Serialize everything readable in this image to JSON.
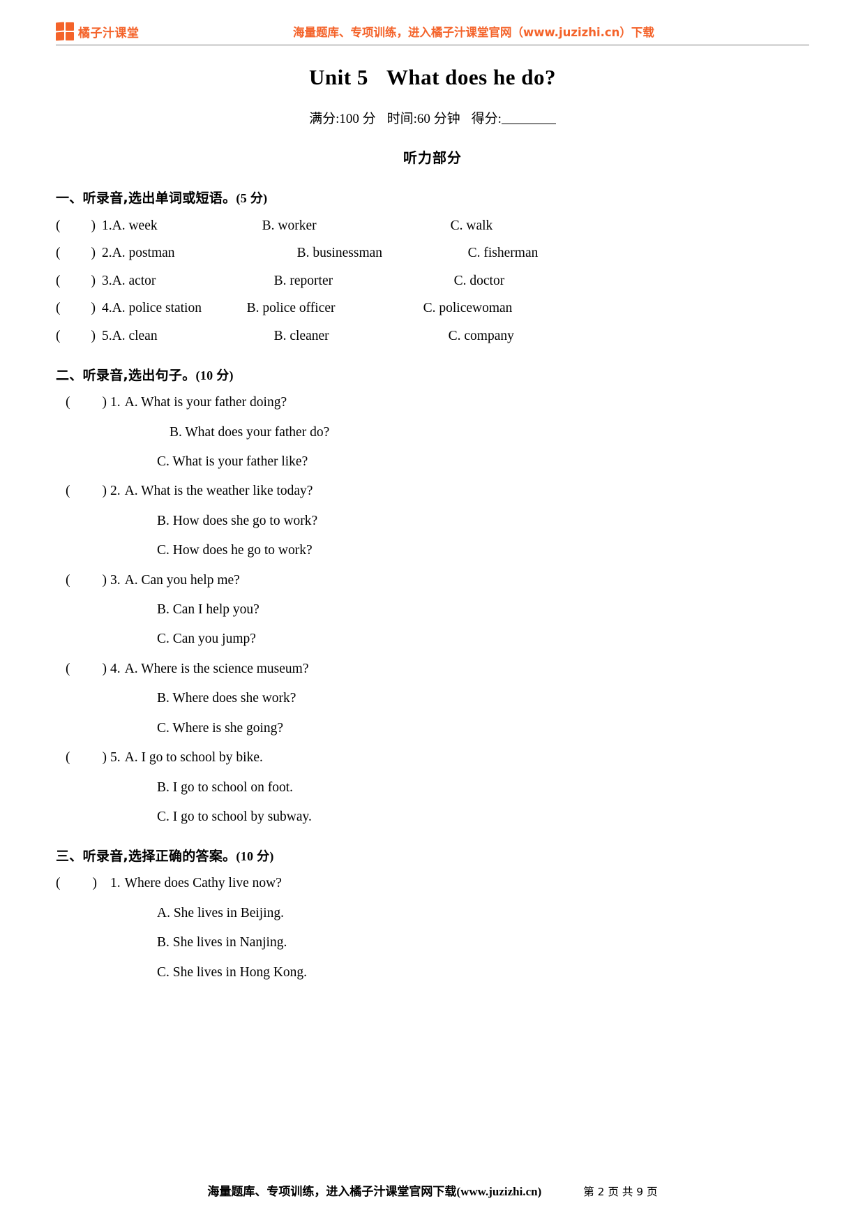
{
  "header": {
    "brand_name": "橘子汁课堂",
    "promo": "海量题库、专项训练，进入橘子汁课堂官网（www.juzizhi.cn）下载"
  },
  "title": {
    "unit": "Unit 5",
    "name": "What does he do?",
    "full_score": "满分:100 分",
    "time": "时间:60 分钟",
    "score_label": "得分:",
    "part": "听力部分"
  },
  "sections": [
    {
      "heading": "一、听录音,选出单词或短语。",
      "points": "(5 分)",
      "layout": "inline",
      "items": [
        {
          "num": "1.",
          "a": "A. week",
          "b": "B. worker",
          "c": "C. walk"
        },
        {
          "num": "2.",
          "a": "A. postman",
          "b": "B. businessman",
          "c": "C. fisherman"
        },
        {
          "num": "3.",
          "a": "A. actor",
          "b": "B. reporter",
          "c": "C. doctor"
        },
        {
          "num": "4.",
          "a": "A. police station",
          "b": "B. police officer",
          "c": "C. policewoman"
        },
        {
          "num": "5.",
          "a": "A. clean",
          "b": "B. cleaner",
          "c": "C. company"
        }
      ]
    },
    {
      "heading": "二、听录音,选出句子。",
      "points": "(10 分)",
      "layout": "stacked",
      "items": [
        {
          "num": "1.",
          "a": "A. What is your father doing?",
          "b": "B. What does your father do?",
          "c": "C. What is your father like?"
        },
        {
          "num": "2.",
          "a": "A. What is the weather like today?",
          "b": "B. How does she go to work?",
          "c": "C. How does he go to work?"
        },
        {
          "num": "3.",
          "a": "A. Can you help me?",
          "b": "B. Can I help you?",
          "c": "C. Can you jump?"
        },
        {
          "num": "4.",
          "a": "A. Where is the science museum?",
          "b": "B. Where does she work?",
          "c": "C. Where is she going?"
        },
        {
          "num": "5.",
          "a": "A. I go to school by bike.",
          "b": "B. I go to school on foot.",
          "c": "C. I go to school by subway."
        }
      ]
    },
    {
      "heading": "三、听录音,选择正确的答案。",
      "points": "(10 分)",
      "layout": "question",
      "items": [
        {
          "num": "1.",
          "question": "Where does Cathy live now?",
          "a": "A. She lives in Beijing.",
          "b": "B. She lives in Nanjing.",
          "c": "C. She lives in Hong Kong."
        }
      ]
    }
  ],
  "footer": {
    "note": "海量题库、专项训练，进入橘子汁课堂官网下载(www.juzizhi.cn)",
    "page": "第 2 页 共 9 页"
  }
}
